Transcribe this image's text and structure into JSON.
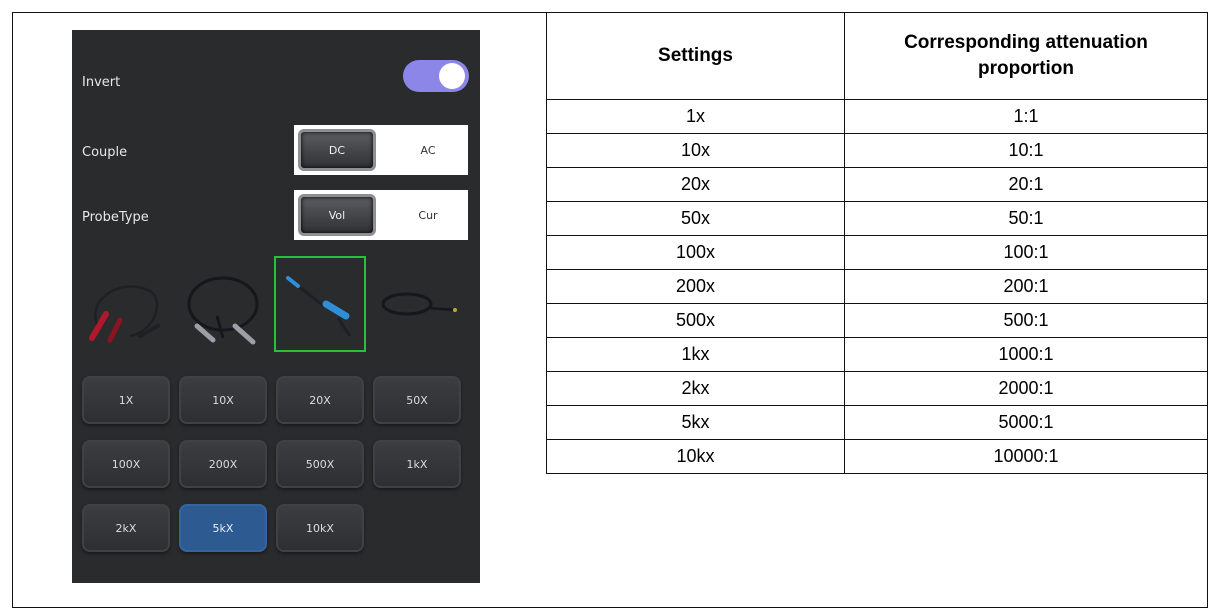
{
  "ui": {
    "invert_label": "Invert",
    "invert_on": true,
    "couple_label": "Couple",
    "couple_options": [
      "DC",
      "AC"
    ],
    "couple_selected": "DC",
    "probe_type_label": "ProbeType",
    "probe_type_options": [
      "Vol",
      "Cur"
    ],
    "probe_type_selected": "Vol",
    "probes": [
      {
        "name": "red-clip-probe-icon",
        "color": "#b0182c"
      },
      {
        "name": "black-clip-probe-icon",
        "color": "#1d2024"
      },
      {
        "name": "blue-tip-probe-icon",
        "color": "#2f8fd6",
        "selected": true
      },
      {
        "name": "coiled-cable-probe-icon",
        "color": "#1d2024"
      }
    ],
    "multiplier_buttons": [
      "1X",
      "10X",
      "20X",
      "50X",
      "100X",
      "200X",
      "500X",
      "1kX",
      "2kX",
      "5kX",
      "10kX"
    ],
    "multiplier_selected": "5kX"
  },
  "table": {
    "headers": [
      "Settings",
      "Corresponding attenuation proportion"
    ],
    "rows": [
      [
        "1x",
        "1:1"
      ],
      [
        "10x",
        "10:1"
      ],
      [
        "20x",
        "20:1"
      ],
      [
        "50x",
        "50:1"
      ],
      [
        "100x",
        "100:1"
      ],
      [
        "200x",
        "200:1"
      ],
      [
        "500x",
        "500:1"
      ],
      [
        "1kx",
        "1000:1"
      ],
      [
        "2kx",
        "2000:1"
      ],
      [
        "5kx",
        "5000:1"
      ],
      [
        "10kx",
        "10000:1"
      ]
    ]
  }
}
